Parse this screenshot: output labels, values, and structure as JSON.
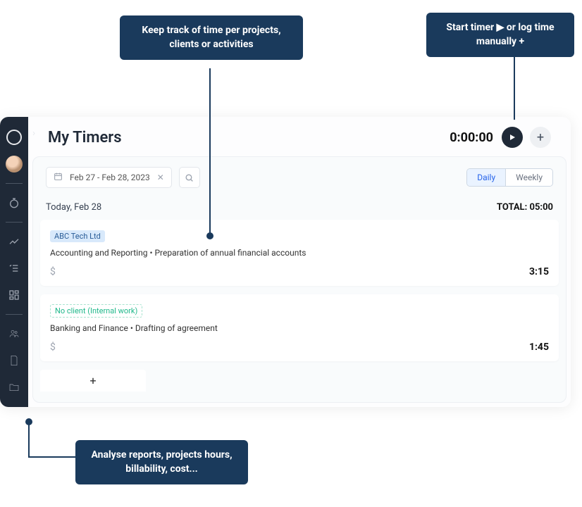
{
  "annotations": {
    "top_left": "Keep track of time per projects, clients or activities",
    "top_right": "Start timer ▶ or log time manually  +",
    "bottom": "Analyse reports, projects hours, billability, cost..."
  },
  "header": {
    "title": "My Timers",
    "timer": "0:00:00"
  },
  "filters": {
    "date_range": "Feb 27 - Feb 28, 2023",
    "view_daily": "Daily",
    "view_weekly": "Weekly"
  },
  "day": {
    "label": "Today, Feb 28",
    "total_label": "TOTAL: 05:00"
  },
  "entries": [
    {
      "client_tag": "ABC Tech Ltd",
      "tag_style": "blue",
      "desc": "Accounting and Reporting • Preparation of annual financial accounts",
      "duration": "3:15"
    },
    {
      "client_tag": "No client (Internal work)",
      "tag_style": "green",
      "desc": "Banking and Finance • Drafting of agreement",
      "duration": "1:45"
    }
  ],
  "add_label": "+"
}
